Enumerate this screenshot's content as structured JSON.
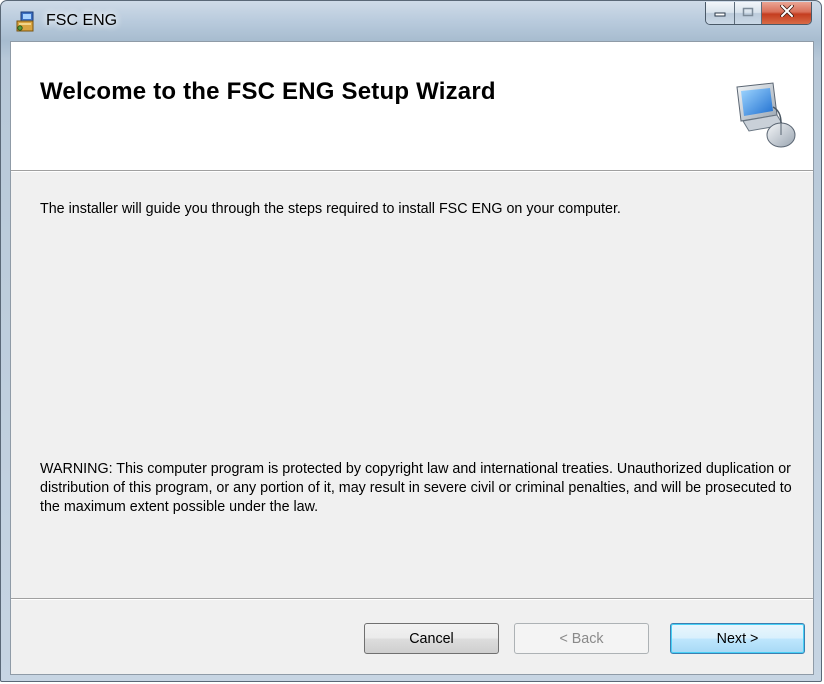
{
  "window": {
    "title": "FSC ENG",
    "icon": "installer-icon",
    "caption_buttons": [
      "minimize-icon",
      "maximize-icon",
      "close-icon"
    ]
  },
  "header": {
    "title": "Welcome to the FSC ENG Setup Wizard",
    "art_icon": "computer-setup-icon"
  },
  "body": {
    "intro": "The installer will guide you through the steps required to install FSC ENG on your computer.",
    "warning": "WARNING: This computer program is protected by copyright law and international treaties. Unauthorized duplication or distribution of this program, or any portion of it, may result in severe civil or criminal penalties, and will be prosecuted to the maximum extent possible under the law."
  },
  "buttons": {
    "cancel": "Cancel",
    "back": "< Back",
    "next": "Next >"
  },
  "colors": {
    "close_button": "#c8472b",
    "next_button_border": "#3c7fb1"
  }
}
